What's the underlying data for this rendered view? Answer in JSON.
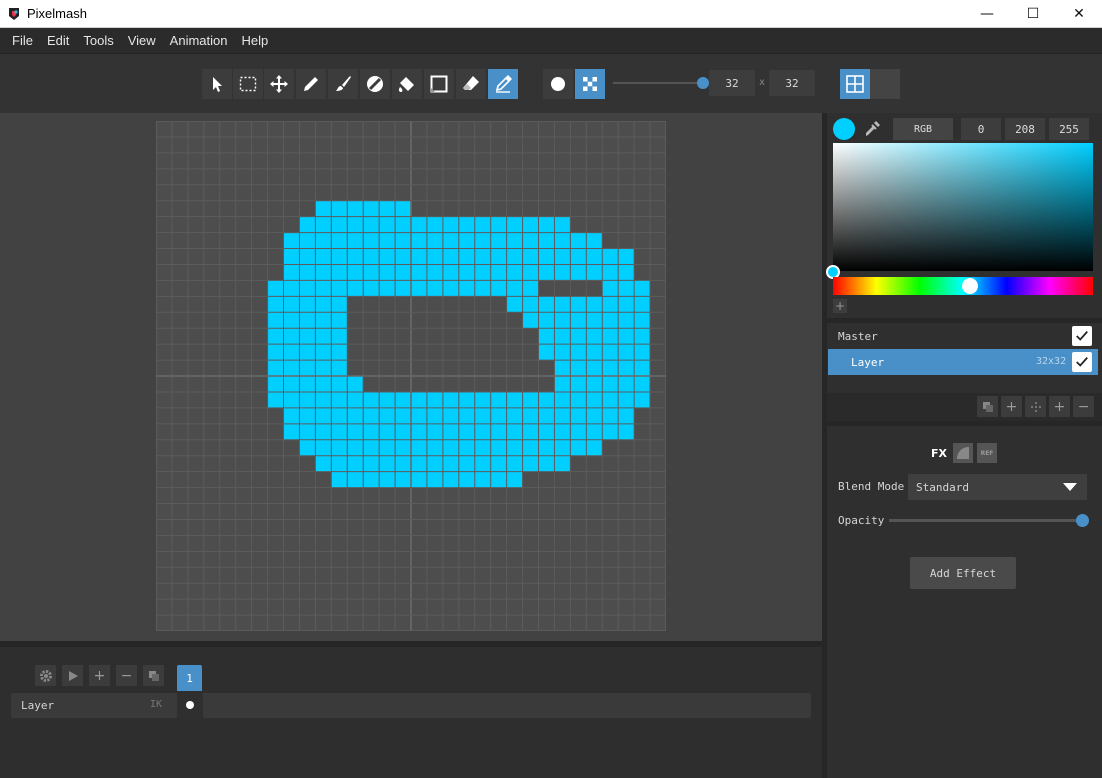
{
  "window": {
    "title": "Pixelmash",
    "minimize_glyph": "—",
    "maximize_glyph": "☐",
    "close_glyph": "✕"
  },
  "menu": [
    "File",
    "Edit",
    "Tools",
    "View",
    "Animation",
    "Help"
  ],
  "toolbar": {
    "tools": [
      "select-arrow-icon",
      "marquee-select-icon",
      "move-icon",
      "pencil-icon",
      "brush-icon",
      "shade-icon",
      "fill-bucket-icon",
      "rectangle-icon",
      "eraser-icon",
      "color-picker-pen-icon"
    ],
    "active_tool": "color-picker-pen-icon",
    "brush_shapes": [
      "round-brush-icon",
      "dither-brush-icon"
    ],
    "active_brush_shape": "dither-brush-icon",
    "brush_size_slider": 1.0,
    "width": "32",
    "size_separator": "x",
    "height": "32",
    "view_buttons": [
      "grid-view-icon",
      "single-view-icon"
    ]
  },
  "canvas": {
    "grid_cols": 32,
    "grid_rows": 32,
    "pixel_color": "#00cfff",
    "rows": [
      "",
      "",
      "",
      "",
      "",
      "..........######..............",
      ".........#################.....",
      "........####################...",
      "........######################.",
      "........######################.",
      ".......#################....###",
      ".......#####..........#########",
      ".......#####...........########",
      ".......#####............#######",
      ".......#####............#######",
      ".......#####.............######",
      ".......######............######",
      ".......########################",
      "........######################.",
      "........######################.",
      ".........###################...",
      "..........################.....",
      "...........############.......",
      "",
      ""
    ]
  },
  "color_panel": {
    "current_color": "#00cfff",
    "mode": "RGB",
    "r": "0",
    "g": "208",
    "b": "255",
    "add_swatch": "+"
  },
  "layers": {
    "master_label": "Master",
    "items": [
      {
        "name": "Layer",
        "size": "32x32"
      }
    ]
  },
  "layer_actions": [
    "duplicate-layer-icon",
    "add-layer-icon",
    "merge-layer-icon",
    "plus-icon",
    "minus-icon"
  ],
  "effects_panel": {
    "tabs": [
      "FX",
      "mask-icon",
      "REF"
    ],
    "blend_mode_label": "Blend Mode",
    "blend_mode_value": "Standard",
    "opacity_label": "Opacity",
    "opacity_value": 1.0,
    "add_effect_label": "Add Effect"
  },
  "timeline": {
    "frame_number": "1",
    "layer_name": "Layer",
    "layer_ik": "IK"
  }
}
